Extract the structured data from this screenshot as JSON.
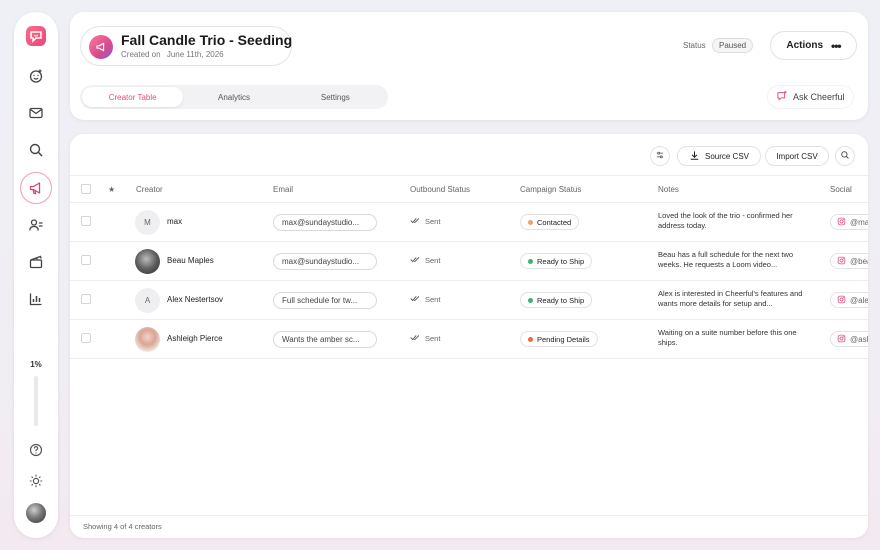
{
  "sidebar": {
    "zoom_label": "1%",
    "zoom_level_percent": 1,
    "items": [
      {
        "name": "logo-icon"
      },
      {
        "name": "smile-plus-icon"
      },
      {
        "name": "mail-icon"
      },
      {
        "name": "search-icon"
      },
      {
        "name": "megaphone-icon"
      },
      {
        "name": "users-icon"
      },
      {
        "name": "clapperboard-icon"
      },
      {
        "name": "bar-chart-icon"
      },
      {
        "name": "help-icon"
      },
      {
        "name": "sun-icon"
      }
    ]
  },
  "header": {
    "title": "Fall Candle Trio - Seeding",
    "created_label": "Created on",
    "created_value": "June 11th, 2026",
    "status_label": "Status",
    "status_value": "Paused",
    "actions_label": "Actions",
    "tabs": [
      {
        "label": "Creator Table",
        "active": true
      },
      {
        "label": "Analytics",
        "active": false
      },
      {
        "label": "Settings",
        "active": false
      }
    ],
    "ask_label": "Ask Cheerful"
  },
  "toolbar": {
    "source_csv": "Source CSV",
    "import_csv": "Import CSV"
  },
  "table": {
    "columns": [
      "Creator",
      "Email",
      "Outbound Status",
      "Campaign Status",
      "Notes",
      "Social"
    ],
    "star_header": "★",
    "rows": [
      {
        "initial": "M",
        "name": "max",
        "email": "max@sundaystudio...",
        "outbound": "Sent",
        "campaign_status": "Contacted",
        "status_color": "#f0a070",
        "notes": "Loved the look of the trio - confirmed her address today.",
        "social": "@ma"
      },
      {
        "initial": "",
        "name": "Beau Maples",
        "email": "max@sundaystudio...",
        "outbound": "Sent",
        "campaign_status": "Ready to Ship",
        "status_color": "#3cb371",
        "notes": "Beau has a full schedule for the next two weeks. He requests a Loom video...",
        "social": "@bea"
      },
      {
        "initial": "A",
        "name": "Alex Nestertsov",
        "email": "Full schedule for tw...",
        "outbound": "Sent",
        "campaign_status": "Ready to Ship",
        "status_color": "#3cb371",
        "notes": "Alex is interested in Cheerful's features and wants more details for setup and...",
        "social": "@ale"
      },
      {
        "initial": "",
        "name": "Ashleigh Pierce",
        "email": "Wants the amber sc...",
        "outbound": "Sent",
        "campaign_status": "Pending Details",
        "status_color": "#f06a3a",
        "notes": "Waiting on a suite number before this one ships.",
        "social": "@ash"
      }
    ],
    "footer": "Showing 4 of 4 creators"
  },
  "colors": {
    "accent": "#e0527e",
    "ready": "#3cb371",
    "pending": "#f06a3a",
    "contacted": "#f0a070"
  }
}
